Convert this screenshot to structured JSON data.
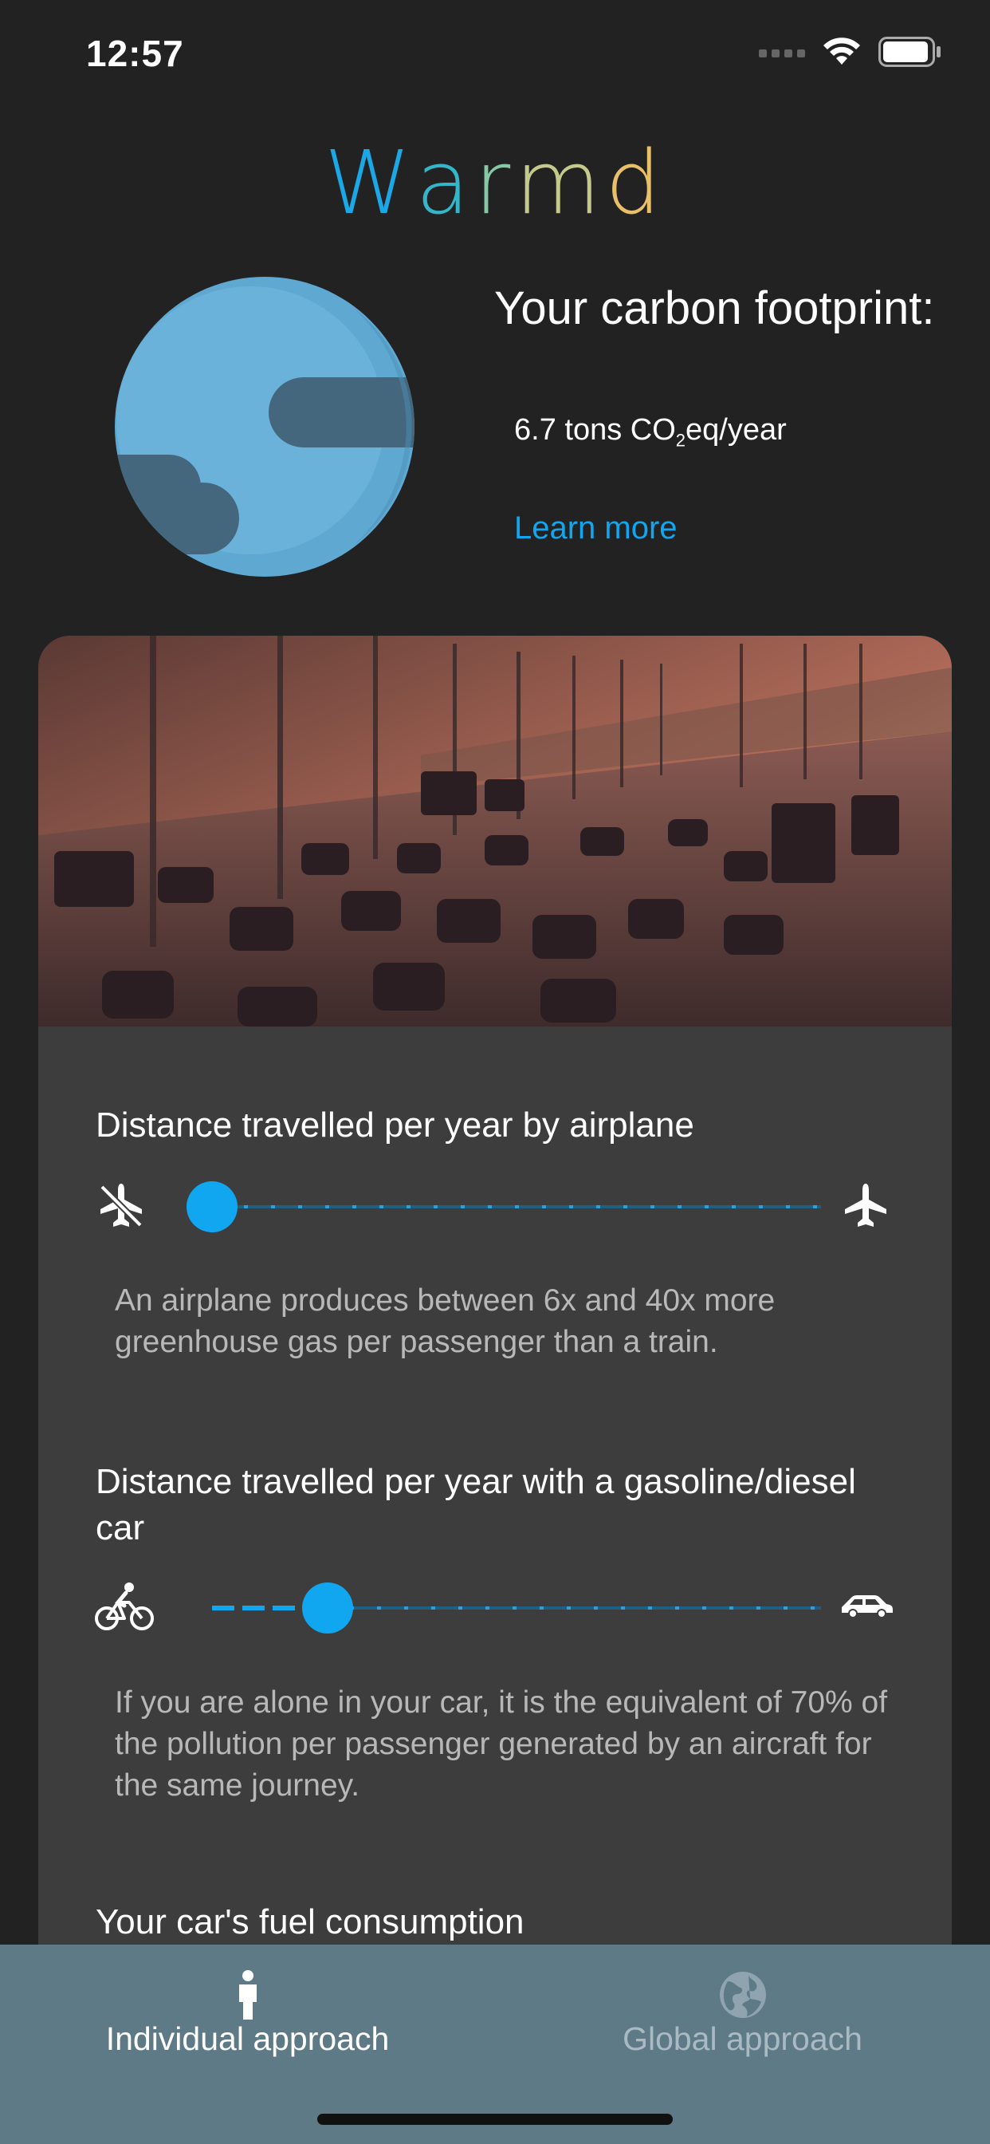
{
  "status": {
    "time": "12:57"
  },
  "app": {
    "title_letters": [
      "W",
      "a",
      "r",
      "m",
      "d"
    ],
    "title_colors": [
      "#1ba8e6",
      "#33b6c9",
      "#86c8a4",
      "#c4c98c",
      "#e8c06a"
    ]
  },
  "footprint": {
    "heading": "Your carbon footprint:",
    "value_prefix": "6.7 tons CO",
    "value_sub": "2",
    "value_suffix": "eq/year",
    "learn_more": "Learn more"
  },
  "airplane": {
    "title": "Distance travelled per year by airplane",
    "desc": "An airplane produces between 6x and 40x more greenhouse gas per passenger than a train.",
    "slider_value": 0.0
  },
  "car": {
    "title": "Distance travelled per year with a gasoline/diesel car",
    "desc": "If you are alone in your car, it is the equivalent of 70% of the pollution per passenger generated by an aircraft for the same journey.",
    "slider_value": 0.19
  },
  "fuel": {
    "title": "Your car's fuel consumption"
  },
  "tabs": [
    {
      "label": "Individual approach",
      "active": true
    },
    {
      "label": "Global approach",
      "active": false
    }
  ],
  "colors": {
    "accent": "#11a6f0",
    "tab_bar": "#5e7a87",
    "card": "#3d3d3d",
    "background": "#222222"
  }
}
